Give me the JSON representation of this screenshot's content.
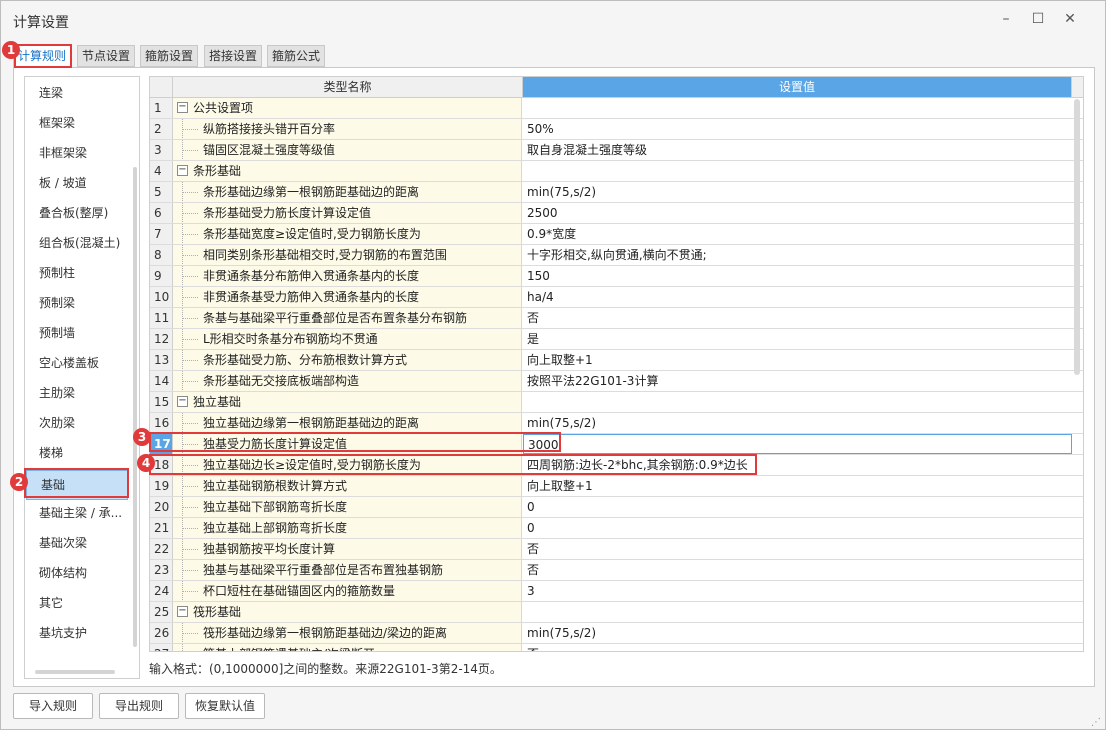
{
  "window": {
    "title": "计算设置",
    "minimize": "–",
    "maximize": "☐",
    "close": "✕"
  },
  "tabs": [
    {
      "label": "计算规则"
    },
    {
      "label": "节点设置"
    },
    {
      "label": "箍筋设置"
    },
    {
      "label": "搭接设置"
    },
    {
      "label": "箍筋公式"
    }
  ],
  "sidebar": {
    "items": [
      {
        "label": "连梁"
      },
      {
        "label": "框架梁"
      },
      {
        "label": "非框架梁"
      },
      {
        "label": "板 / 坡道"
      },
      {
        "label": "叠合板(整厚)"
      },
      {
        "label": "组合板(混凝土)"
      },
      {
        "label": "预制柱"
      },
      {
        "label": "预制梁"
      },
      {
        "label": "预制墙"
      },
      {
        "label": "空心楼盖板"
      },
      {
        "label": "主肋梁"
      },
      {
        "label": "次肋梁"
      },
      {
        "label": "楼梯"
      },
      {
        "label": "基础"
      },
      {
        "label": "基础主梁 / 承..."
      },
      {
        "label": "基础次梁"
      },
      {
        "label": "砌体结构"
      },
      {
        "label": "其它"
      },
      {
        "label": "基坑支护"
      }
    ]
  },
  "grid": {
    "header": {
      "name": "类型名称",
      "value": "设置值"
    },
    "rows": [
      {
        "num": "1",
        "name": "公共设置项",
        "value": "",
        "group": true
      },
      {
        "num": "2",
        "name": "纵筋搭接接头错开百分率",
        "value": "50%"
      },
      {
        "num": "3",
        "name": "锚固区混凝土强度等级值",
        "value": "取自身混凝土强度等级"
      },
      {
        "num": "4",
        "name": "条形基础",
        "value": "",
        "group": true
      },
      {
        "num": "5",
        "name": "条形基础边缘第一根钢筋距基础边的距离",
        "value": "min(75,s/2)"
      },
      {
        "num": "6",
        "name": "条形基础受力筋长度计算设定值",
        "value": "2500"
      },
      {
        "num": "7",
        "name": "条形基础宽度≥设定值时,受力钢筋长度为",
        "value": "0.9*宽度"
      },
      {
        "num": "8",
        "name": "相同类别条形基础相交时,受力钢筋的布置范围",
        "value": "十字形相交,纵向贯通,横向不贯通;"
      },
      {
        "num": "9",
        "name": "非贯通条基分布筋伸入贯通条基内的长度",
        "value": "150"
      },
      {
        "num": "10",
        "name": "非贯通条基受力筋伸入贯通条基内的长度",
        "value": "ha/4"
      },
      {
        "num": "11",
        "name": "条基与基础梁平行重叠部位是否布置条基分布钢筋",
        "value": "否"
      },
      {
        "num": "12",
        "name": "L形相交时条基分布钢筋均不贯通",
        "value": "是"
      },
      {
        "num": "13",
        "name": "条形基础受力筋、分布筋根数计算方式",
        "value": "向上取整+1"
      },
      {
        "num": "14",
        "name": "条形基础无交接底板端部构造",
        "value": "按照平法22G101-3计算"
      },
      {
        "num": "15",
        "name": "独立基础",
        "value": "",
        "group": true
      },
      {
        "num": "16",
        "name": "独立基础边缘第一根钢筋距基础边的距离",
        "value": "min(75,s/2)"
      },
      {
        "num": "17",
        "name": "独基受力筋长度计算设定值",
        "value": "3000",
        "selected": true
      },
      {
        "num": "18",
        "name": "独立基础边长≥设定值时,受力钢筋长度为",
        "value": "四周钢筋:边长-2*bhc,其余钢筋:0.9*边长"
      },
      {
        "num": "19",
        "name": "独立基础钢筋根数计算方式",
        "value": "向上取整+1"
      },
      {
        "num": "20",
        "name": "独立基础下部钢筋弯折长度",
        "value": "0"
      },
      {
        "num": "21",
        "name": "独立基础上部钢筋弯折长度",
        "value": "0"
      },
      {
        "num": "22",
        "name": "独基钢筋按平均长度计算",
        "value": "否"
      },
      {
        "num": "23",
        "name": "独基与基础梁平行重叠部位是否布置独基钢筋",
        "value": "否"
      },
      {
        "num": "24",
        "name": "杯口短柱在基础锚固区内的箍筋数量",
        "value": "3"
      },
      {
        "num": "25",
        "name": "筏形基础",
        "value": "",
        "group": true
      },
      {
        "num": "26",
        "name": "筏形基础边缘第一根钢筋距基础边/梁边的距离",
        "value": "min(75,s/2)"
      },
      {
        "num": "27",
        "name": "筏基上部钢筋遇基础主/次梁断开",
        "value": "否"
      }
    ]
  },
  "status": "输入格式：(0,1000000]之间的整数。来源22G101-3第2-14页。",
  "buttons": {
    "import": "导入规则",
    "export": "导出规则",
    "restore": "恢复默认值"
  },
  "annotations": [
    {
      "label": "1"
    },
    {
      "label": "2"
    },
    {
      "label": "3"
    },
    {
      "label": "4"
    }
  ],
  "colors": {
    "accent_red": "#e03a3a",
    "header_blue": "#5aa5e6",
    "name_cell_bg": "#fdfbe8",
    "selected_blue": "#c6e0f7"
  }
}
